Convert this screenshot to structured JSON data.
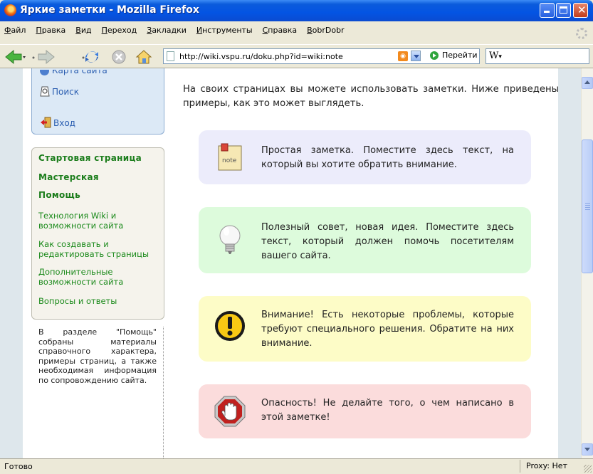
{
  "window": {
    "title": "Яркие заметки - Mozilla Firefox"
  },
  "menu": [
    "Файл",
    "Правка",
    "Вид",
    "Переход",
    "Закладки",
    "Инструменты",
    "Справка",
    "BobrDobr"
  ],
  "navbar": {
    "url": "http://wiki.vspu.ru/doku.php?id=wiki:note",
    "go_label": "Перейти",
    "search_engine": "W"
  },
  "sidebar": {
    "tools": [
      {
        "label": "Карта сайта",
        "icon": "sitemap-icon"
      },
      {
        "label": "Поиск",
        "icon": "search-icon"
      },
      {
        "label": "Вход",
        "icon": "login-icon"
      }
    ],
    "nav_bold": [
      "Стартовая страница",
      "Мастерская",
      "Помощь"
    ],
    "nav_links": [
      "Технология Wiki и возможности сайта",
      "Как создавать и редактировать страницы",
      "Дополнительные возможности сайта",
      "Вопросы и ответы"
    ],
    "description": "В разделе \"Помощь\" собраны материалы справочного характера, примеры страниц, а также необходимая информация по сопровождению сайта."
  },
  "main": {
    "intro": "На своих страницах вы можете использовать заметки. Ниже приведены примеры, как это может выглядеть.",
    "notes": [
      {
        "type": "note",
        "icon": "note-icon",
        "icon_text": "note",
        "text": "Простая заметка. Поместите здесь текст, на который вы хотите обратить внимание.",
        "bg": "#ececfb"
      },
      {
        "type": "tip",
        "icon": "lightbulb-icon",
        "text": "Полезный совет, новая идея. Поместите здесь текст, который должен помочь посетителям вашего сайта.",
        "bg": "#ddfbdc"
      },
      {
        "type": "important",
        "icon": "warning-icon",
        "text": "Внимание! Есть некоторые проблемы, которые требуют специального решения. Обратите на них внимание.",
        "bg": "#fdfcc7"
      },
      {
        "type": "warning",
        "icon": "stop-hand-icon",
        "text": "Опасность! Не делайте того, о чем написано в этой заметке!",
        "bg": "#fbdcdc"
      }
    ]
  },
  "status": {
    "text": "Готово",
    "proxy": "Proxy: Нет"
  }
}
